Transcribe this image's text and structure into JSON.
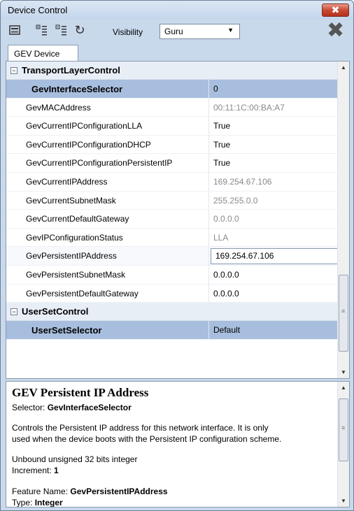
{
  "window": {
    "title": "Device Control",
    "close_label": "✖"
  },
  "toolbar": {
    "visibility_label": "Visibility",
    "visibility_value": "Guru",
    "dropdown_arrow": "▼"
  },
  "tabs": [
    {
      "label": "GEV Device"
    }
  ],
  "grid": {
    "categories": [
      {
        "label": "TransportLayerControl"
      },
      {
        "label": "UserSetControl"
      }
    ],
    "rows": [
      {
        "name": "GevInterfaceSelector",
        "value": "0"
      },
      {
        "name": "GevMACAddress",
        "value": "00:11:1C:00:BA:A7"
      },
      {
        "name": "GevCurrentIPConfigurationLLA",
        "value": "True"
      },
      {
        "name": "GevCurrentIPConfigurationDHCP",
        "value": "True"
      },
      {
        "name": "GevCurrentIPConfigurationPersistentIP",
        "value": "True"
      },
      {
        "name": "GevCurrentIPAddress",
        "value": "169.254.67.106"
      },
      {
        "name": "GevCurrentSubnetMask",
        "value": "255.255.0.0"
      },
      {
        "name": "GevCurrentDefaultGateway",
        "value": "0.0.0.0"
      },
      {
        "name": "GevIPConfigurationStatus",
        "value": "LLA"
      },
      {
        "name": "GevPersistentIPAddress",
        "value": "169.254.67.106"
      },
      {
        "name": "GevPersistentSubnetMask",
        "value": "0.0.0.0"
      },
      {
        "name": "GevPersistentDefaultGateway",
        "value": "0.0.0.0"
      },
      {
        "name": "UserSetSelector",
        "value": "Default"
      }
    ]
  },
  "description": {
    "title": "GEV Persistent IP Address",
    "selector_label": "Selector:",
    "selector_value": "GevInterfaceSelector",
    "body_line1": "Controls the Persistent IP address for this network interface. It is only",
    "body_line2": "used when the device boots with the Persistent IP configuration scheme.",
    "type_desc": "Unbound unsigned 32 bits integer",
    "increment_label": "Increment:",
    "increment_value": "1",
    "feature_label": "Feature Name:",
    "feature_value": "GevPersistentIPAddress",
    "type_label": "Type:",
    "type_value": "Integer"
  },
  "icons": [
    "panel-icon",
    "expand-all-icon",
    "collapse-all-icon",
    "refresh-icon",
    "delete-x-icon"
  ]
}
